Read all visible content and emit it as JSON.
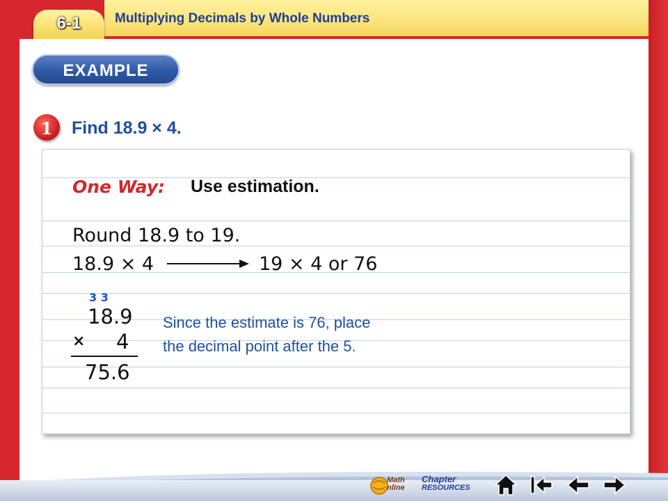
{
  "header": {
    "lesson_number": "6-1",
    "title": "Multiplying Decimals by Whole Numbers"
  },
  "example_label": "EXAMPLE",
  "step": {
    "number": "1",
    "question": "Find 18.9 × 4."
  },
  "method": {
    "label": "One Way:",
    "text": "Use estimation."
  },
  "work": {
    "round_line": "Round 18.9 to 19.",
    "estimate_left": "18.9 × 4",
    "estimate_right": "19 × 4 or 76",
    "carries": "3 3",
    "top_number": "18.9",
    "times_symbol": "×",
    "multiplier": "4",
    "product": "75.6"
  },
  "explanation": {
    "line1": "Since the estimate is 76, place",
    "line2": "the decimal point after the 5."
  },
  "nav": {
    "math_online_line1": "Math",
    "math_online_line2": "nline",
    "chapter_line1": "Chapter",
    "chapter_line2": "RESOURCES",
    "icons": [
      "home-icon",
      "first-slide-icon",
      "previous-icon",
      "next-icon"
    ]
  },
  "colors": {
    "frame_red": "#d7262d",
    "title_blue": "#1f3f8f",
    "accent_blue": "#1f4f9f",
    "way_red": "#d4262d",
    "rule_blue": "#b7d4ef"
  }
}
